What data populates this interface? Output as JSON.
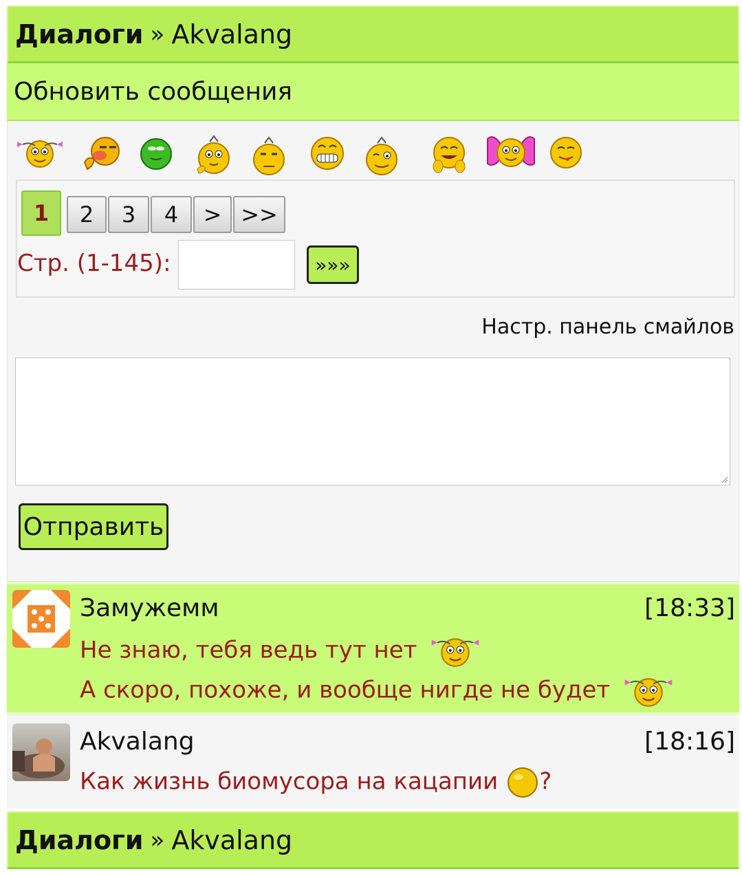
{
  "header": {
    "section": "Диалоги",
    "separator": "»",
    "user": "Akvalang"
  },
  "refresh_label": "Обновить сообщения",
  "smileys": [
    "pigtails-smile-icon",
    "blush-smile-icon",
    "green-smile-icon",
    "thinking-smile-icon",
    "hmm-smile-icon",
    "grin-smile-icon",
    "wink-smile-icon",
    "laugh-smile-icon",
    "bow-smile-icon",
    "tongue-smile-icon"
  ],
  "pagination": {
    "current": "1",
    "pages": [
      "2",
      "3",
      "4"
    ],
    "next": ">",
    "last": ">>",
    "goto_label": "Стр. (1-145):",
    "goto_value": "",
    "goto_button": "»»»"
  },
  "smile_settings_label": "Настр. панель смайлов",
  "compose": {
    "value": "",
    "send_label": "Отправить"
  },
  "messages": [
    {
      "author": "Замужемм",
      "time": "[18:33]",
      "lines": [
        "Не знаю, тебя ведь тут нет",
        "А скоро, похоже, и вообще нигде не будет"
      ]
    },
    {
      "author": "Akvalang",
      "time": "[18:16]",
      "lines": [
        "Как жизнь биомусора на кацапии",
        "?"
      ]
    }
  ],
  "colors": {
    "header_green": "#b8ee55",
    "refresh_green": "#c8fb77",
    "message_red": "#9b1c1c",
    "panel_gray": "#f5f5f5"
  }
}
